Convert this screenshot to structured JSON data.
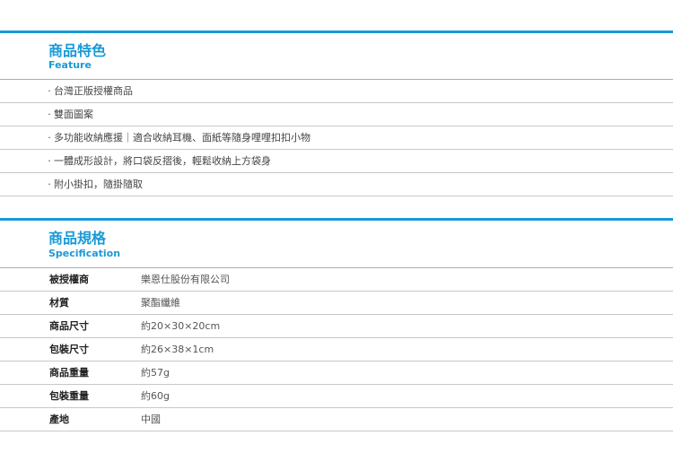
{
  "feature": {
    "title": "商品特色",
    "subtitle": "Feature",
    "bullet": "·",
    "items": [
      "台灣正版授權商品",
      "雙面圖案",
      "多功能收納應援｜適合收納耳機、面紙等隨身哩哩扣扣小物",
      "一體成形設計，將口袋反摺後，輕鬆收納上方袋身",
      "附小掛扣，隨掛隨取"
    ]
  },
  "specification": {
    "title": "商品規格",
    "subtitle": "Specification",
    "rows": [
      {
        "label": "被授權商",
        "value": "樂恩仕股份有限公司"
      },
      {
        "label": "材質",
        "value": "聚酯纖維"
      },
      {
        "label": "商品尺寸",
        "value": "約20×30×20cm"
      },
      {
        "label": "包裝尺寸",
        "value": "約26×38×1cm"
      },
      {
        "label": "商品重量",
        "value": "約57g"
      },
      {
        "label": "包裝重量",
        "value": "約60g"
      },
      {
        "label": "產地",
        "value": "中國"
      }
    ]
  },
  "colors": {
    "accent": "#1a9ad6",
    "divider": "#c8c8c8"
  }
}
